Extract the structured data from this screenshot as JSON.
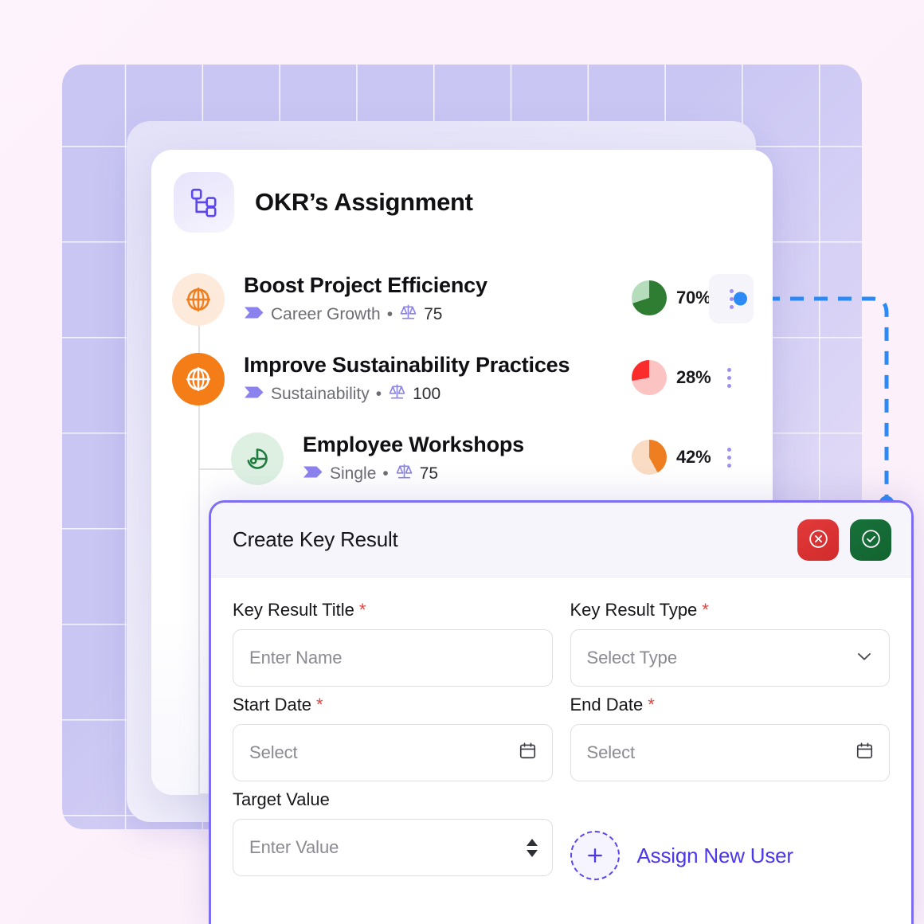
{
  "card": {
    "title": "OKR’s Assignment",
    "header_icon": "hierarchy-icon"
  },
  "okrs": [
    {
      "name": "Boost Project Efficiency",
      "category": "Career Growth",
      "separator": "•",
      "weight": "75",
      "progress_label": "70%",
      "progress_value": 70,
      "progress_color": "#2e7d32",
      "progress_track": "#b6ddbb",
      "avatar_icon": "target-icon",
      "avatar_style": "soft-orange",
      "badge_icon": "flag-chevron-icon",
      "scale_icon": "balance-scale-icon",
      "menu_icon": "kebab-menu-icon",
      "selected": true
    },
    {
      "name": "Improve Sustainability Practices",
      "category": "Sustainability",
      "separator": "•",
      "weight": "100",
      "progress_label": "28%",
      "progress_value": 28,
      "progress_color": "#fa2c2c",
      "progress_track": "#fcc3c3",
      "avatar_icon": "target-icon",
      "avatar_style": "solid-orange",
      "badge_icon": "flag-chevron-icon",
      "scale_icon": "balance-scale-icon",
      "menu_icon": "kebab-menu-icon",
      "selected": false
    },
    {
      "name": "Employee Workshops",
      "category": "Single",
      "separator": "•",
      "weight": "75",
      "progress_label": "42%",
      "progress_value": 42,
      "progress_color": "#ef7e20",
      "progress_track": "#fadcc4",
      "avatar_icon": "donut-chart-icon",
      "avatar_style": "soft-green",
      "badge_icon": "flag-chevron-icon",
      "scale_icon": "balance-scale-icon",
      "menu_icon": "kebab-menu-icon",
      "selected": false
    }
  ],
  "modal": {
    "title": "Create Key Result",
    "cancel_icon": "close-circle-icon",
    "confirm_icon": "check-circle-icon",
    "fields": {
      "title": {
        "label": "Key Result Title",
        "required": "*",
        "placeholder": "Enter Name"
      },
      "type": {
        "label": "Key Result Type",
        "required": "*",
        "placeholder": "Select Type",
        "icon": "chevron-down-icon"
      },
      "start_date": {
        "label": "Start Date",
        "required": "*",
        "placeholder": "Select",
        "icon": "calendar-icon"
      },
      "end_date": {
        "label": "End Date",
        "required": "*",
        "placeholder": "Select",
        "icon": "calendar-icon"
      },
      "target_value": {
        "label": "Target Value",
        "required": "",
        "placeholder": "Enter Value",
        "icon": "number-stepper-icon"
      }
    },
    "assign": {
      "label": "Assign New User",
      "icon": "plus-icon"
    }
  },
  "colors": {
    "accent_purple": "#5b46ef",
    "modal_border": "#7d6df0",
    "connector_blue": "#2b8af5",
    "grid_purple": "#c9c6f3",
    "page_bg": "#fdf1fb"
  }
}
